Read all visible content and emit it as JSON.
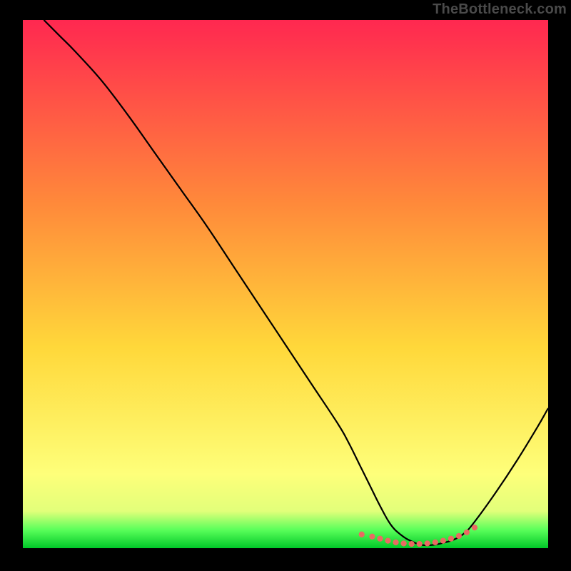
{
  "watermark": "TheBottleneck.com",
  "colors": {
    "bg": "#000000",
    "curve": "#000000",
    "dots": "#ea6a62",
    "grad_top": "#ff2850",
    "grad_upper_mid": "#ff8a3a",
    "grad_mid": "#ffd83a",
    "grad_lowband_top": "#feff7a",
    "grad_lowband_bot": "#e2ff7a",
    "grad_green_top": "#5bff5b",
    "grad_green_bot": "#00c828"
  },
  "chart_data": {
    "type": "line",
    "title": "",
    "xlabel": "",
    "ylabel": "",
    "xlim": [
      0,
      100
    ],
    "ylim": [
      0,
      100
    ],
    "grid": false,
    "series": [
      {
        "name": "bottleneck-curve",
        "x": [
          4,
          7,
          10,
          15,
          20,
          25,
          30,
          35,
          40,
          45,
          50,
          55,
          60,
          62,
          64,
          66,
          68,
          70,
          72,
          74,
          76,
          78,
          80,
          82,
          84,
          86,
          90,
          94,
          98,
          100
        ],
        "y": [
          100,
          97,
          94,
          88.5,
          82,
          75,
          68,
          61,
          53.5,
          46,
          38.5,
          31,
          23.5,
          20,
          16,
          12,
          8,
          4.5,
          2.5,
          1.3,
          0.6,
          0.6,
          1.0,
          1.6,
          2.8,
          5.0,
          10.5,
          16.5,
          23,
          26.5
        ]
      }
    ],
    "marker_points": {
      "name": "valley-dots",
      "x": [
        64.5,
        66.5,
        68,
        69.5,
        71,
        72.5,
        74,
        75.5,
        77,
        78.5,
        80,
        81.5,
        83,
        84.5,
        86
      ],
      "y": [
        2.6,
        2.2,
        1.8,
        1.4,
        1.1,
        0.9,
        0.8,
        0.8,
        0.9,
        1.1,
        1.4,
        1.8,
        2.3,
        3.0,
        3.9
      ]
    }
  }
}
